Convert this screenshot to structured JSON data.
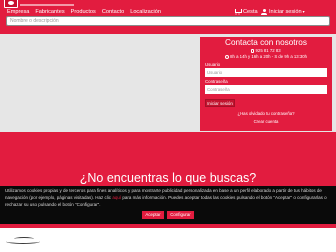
{
  "nav": {
    "items": [
      {
        "label": "Empresa"
      },
      {
        "label": "Fabricantes"
      },
      {
        "label": "Productos"
      },
      {
        "label": "Contacto"
      },
      {
        "label": "Localización"
      }
    ]
  },
  "header": {
    "cart_label": "Cesta",
    "login_label": "Iniciar sesión"
  },
  "search": {
    "placeholder": "Nombre o descripción"
  },
  "login_panel": {
    "title": "Contacta con nosotros",
    "phone": "925 81 72 83",
    "hours": "8h a 14h y 16h a 20h - S de 9h a 13:30h",
    "username_label": "Usuario",
    "username_placeholder": "Usuario",
    "password_label": "Contraseña",
    "password_placeholder": "Contraseña",
    "submit_label": "Iniciar sesión",
    "forgot_label": "¿Has olvidado tu contraseña?",
    "create_label": "Crear cuenta"
  },
  "main": {
    "headline": "¿No encuentras lo que buscas?"
  },
  "cookie_banner": {
    "text_1": "Utilizamos cookies propias y de terceros para fines analíticos y para mostrarte publicidad personalizada en base a un perfil elaborado a partir de tus hábitos de navegación (por ejemplo, páginas visitadas). Haz clic ",
    "link_text": "aquí",
    "text_2": " para más información. Puedes aceptar todas las cookies pulsando el botón \"Aceptar\" o configurarlas o rechazar su uso pulsando el botón \"Configurar\".",
    "accept_label": "Aceptar",
    "configure_label": "Configurar"
  },
  "colors": {
    "brand_red": "#e21c3f",
    "banner_black": "#0a0a0a",
    "middle_grey": "#e6e6e6"
  }
}
